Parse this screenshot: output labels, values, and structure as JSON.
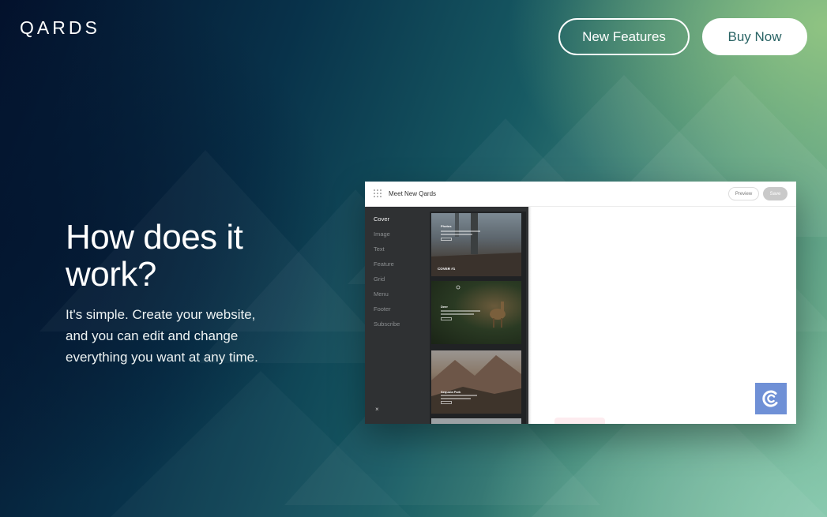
{
  "header": {
    "logo": "QARDS",
    "nav": {
      "new_features_label": "New Features",
      "buy_now_label": "Buy Now"
    }
  },
  "hero": {
    "title": "How does it work?",
    "text": "It's simple. Create your website, and you can edit and change everything you want at any time."
  },
  "mockup": {
    "title": "Meet New Qards",
    "preview_label": "Preview",
    "save_label": "Save",
    "menu": [
      "Cover",
      "Image",
      "Text",
      "Feature",
      "Grid",
      "Menu",
      "Footer",
      "Subscribe"
    ],
    "active_item": "Cover",
    "close_glyph": "×",
    "thumbs": {
      "t1_title": "Photos",
      "t1_label": "COVER #1",
      "t2_title": "Deer",
      "t3_title": "Sequoia Park"
    },
    "chat_icon": "qards-chat-icon"
  },
  "colors": {
    "accent_teal": "#2a6465",
    "chat_badge": "#6f90d6"
  }
}
